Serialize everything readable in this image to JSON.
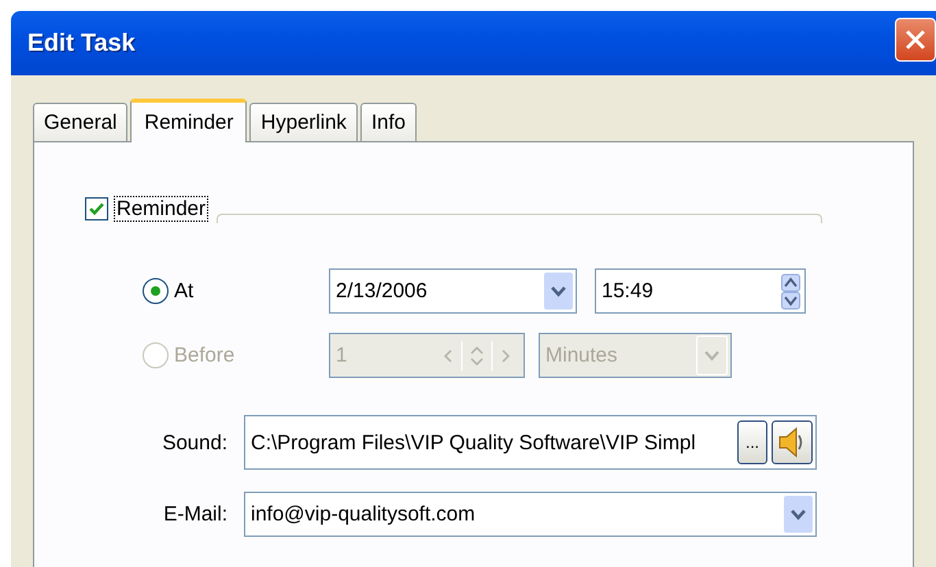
{
  "window": {
    "title": "Edit Task"
  },
  "tabs": [
    {
      "label": "General",
      "selected": false
    },
    {
      "label": "Reminder",
      "selected": true
    },
    {
      "label": "Hyperlink",
      "selected": false
    },
    {
      "label": "Info",
      "selected": false
    }
  ],
  "reminder": {
    "label": "Reminder",
    "checked": true
  },
  "at": {
    "label": "At",
    "selected": true,
    "date": "2/13/2006",
    "time": "15:49"
  },
  "before": {
    "label": "Before",
    "selected": false,
    "disabled": true,
    "amount": "1",
    "unit": "Minutes"
  },
  "sound": {
    "label": "Sound:",
    "value": "C:\\Program Files\\VIP Quality Software\\VIP Simpl",
    "browse_button": "..."
  },
  "email": {
    "label": "E-Mail:",
    "value": "info@vip-qualitysoft.com"
  }
}
